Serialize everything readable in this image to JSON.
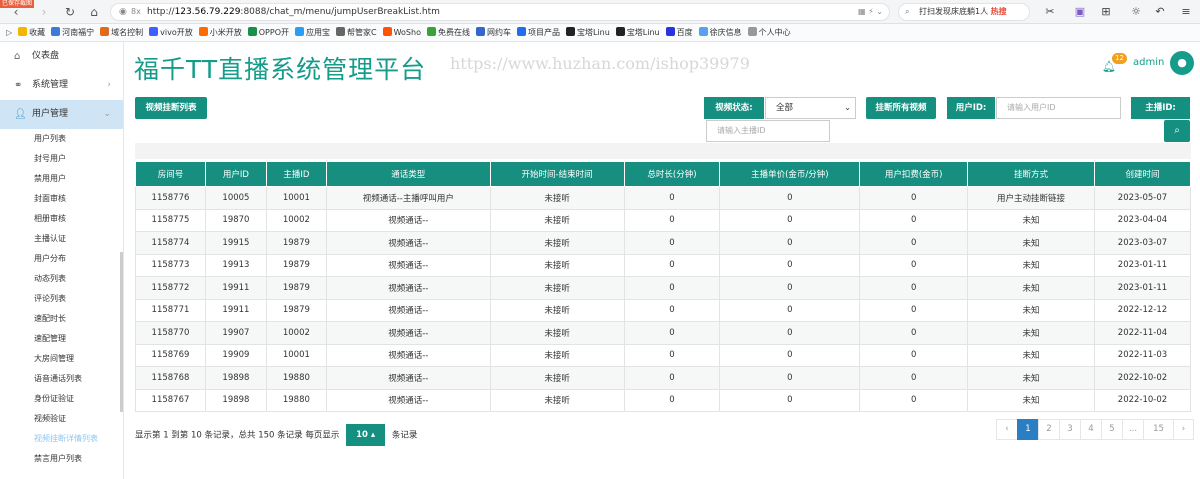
{
  "browser": {
    "badge": "已保存截图",
    "url_prefix": "http://",
    "url_host": "123.56.79.229",
    "url_rest": ":8088/chat_m/menu/jumpUserBreakList.htm",
    "url_icon": "8x",
    "search_text": "打扫发现床底躺1人",
    "search_hot": "热搜"
  },
  "bookmarks": [
    {
      "label": "收藏",
      "color": "#f5b400"
    },
    {
      "label": "河南福宁",
      "color": "#3a7bd5"
    },
    {
      "label": "域名控制",
      "color": "#e06a1b"
    },
    {
      "label": "vivo开放",
      "color": "#415fff"
    },
    {
      "label": "小米开放",
      "color": "#ff6900"
    },
    {
      "label": "OPPO开",
      "color": "#1a8f4a"
    },
    {
      "label": "应用宝",
      "color": "#2a9df4"
    },
    {
      "label": "帮管家C",
      "color": "#666666"
    },
    {
      "label": "WoSho",
      "color": "#ff5500"
    },
    {
      "label": "免费在线",
      "color": "#37a33b"
    },
    {
      "label": "网约车",
      "color": "#3366cc"
    },
    {
      "label": "项目产品",
      "color": "#1f6feb"
    },
    {
      "label": "宝塔Linu",
      "color": "#222222"
    },
    {
      "label": "宝塔Linu",
      "color": "#222222"
    },
    {
      "label": "百度",
      "color": "#2932e1"
    },
    {
      "label": "徐庆信息",
      "color": "#59a0f0"
    },
    {
      "label": "个人中心",
      "color": "#999999"
    }
  ],
  "header": {
    "title": "福千TT直播系统管理平台",
    "watermark": "https://www.huzhan.com/ishop39979",
    "notification_count": "12",
    "username": "admin"
  },
  "sidebar": {
    "items": [
      {
        "label": "仪表盘",
        "icon": "home-icon"
      },
      {
        "label": "系统管理",
        "icon": "sitemap-icon",
        "arrow": "›"
      },
      {
        "label": "用户管理",
        "icon": "user-icon",
        "arrow": "⌄"
      }
    ],
    "subitems": [
      "用户列表",
      "封号用户",
      "禁用用户",
      "封面审核",
      "相册审核",
      "主播认证",
      "用户分布",
      "动态列表",
      "评论列表",
      "速配时长",
      "速配管理",
      "大房间管理",
      "语音通话列表",
      "身份证验证",
      "视频验证",
      "视频挂断详情列表",
      "禁言用户列表"
    ],
    "current_index": 15
  },
  "toolbar": {
    "list_button": "视频挂断列表",
    "status_label": "视频状态:",
    "status_value": "全部",
    "hangup_all_button": "挂断所有视频",
    "user_id_label": "用户ID:",
    "user_id_placeholder": "请输入用户ID",
    "anchor_id_label": "主播ID:",
    "anchor_id_placeholder": "请输入主播ID"
  },
  "table": {
    "columns": [
      "房间号",
      "用户ID",
      "主播ID",
      "通话类型",
      "开始时间-结束时间",
      "总时长(分钟)",
      "主播单价(金币/分钟)",
      "用户扣费(金币)",
      "挂断方式",
      "创建时间"
    ],
    "rows": [
      [
        "1158776",
        "10005",
        "10001",
        "视频通话--主播呼叫用户",
        "未接听",
        "0",
        "0",
        "0",
        "用户主动挂断链接",
        "2023-05-07"
      ],
      [
        "1158775",
        "19870",
        "10002",
        "视频通话--",
        "未接听",
        "0",
        "0",
        "0",
        "未知",
        "2023-04-04"
      ],
      [
        "1158774",
        "19915",
        "19879",
        "视频通话--",
        "未接听",
        "0",
        "0",
        "0",
        "未知",
        "2023-03-07"
      ],
      [
        "1158773",
        "19913",
        "19879",
        "视频通话--",
        "未接听",
        "0",
        "0",
        "0",
        "未知",
        "2023-01-11"
      ],
      [
        "1158772",
        "19911",
        "19879",
        "视频通话--",
        "未接听",
        "0",
        "0",
        "0",
        "未知",
        "2023-01-11"
      ],
      [
        "1158771",
        "19911",
        "19879",
        "视频通话--",
        "未接听",
        "0",
        "0",
        "0",
        "未知",
        "2022-12-12"
      ],
      [
        "1158770",
        "19907",
        "10002",
        "视频通话--",
        "未接听",
        "0",
        "0",
        "0",
        "未知",
        "2022-11-04"
      ],
      [
        "1158769",
        "19909",
        "10001",
        "视频通话--",
        "未接听",
        "0",
        "0",
        "0",
        "未知",
        "2022-11-03"
      ],
      [
        "1158768",
        "19898",
        "19880",
        "视频通话--",
        "未接听",
        "0",
        "0",
        "0",
        "未知",
        "2022-10-02"
      ],
      [
        "1158767",
        "19898",
        "19880",
        "视频通话--",
        "未接听",
        "0",
        "0",
        "0",
        "未知",
        "2022-10-02"
      ]
    ]
  },
  "footer": {
    "summary": "显示第 1 到第 10 条记录，总共 150 条记录 每页显示",
    "page_size": "10",
    "page_size_caret": "▴",
    "suffix": "条记录"
  },
  "pagination": {
    "prev": "‹",
    "pages": [
      "1",
      "2",
      "3",
      "4",
      "5"
    ],
    "ellipsis": "...",
    "last_page": "15",
    "next": "›",
    "current": "1"
  },
  "colors": {
    "primary": "#148f80",
    "title": "#159c8a",
    "active_page": "#2a7fc4"
  }
}
